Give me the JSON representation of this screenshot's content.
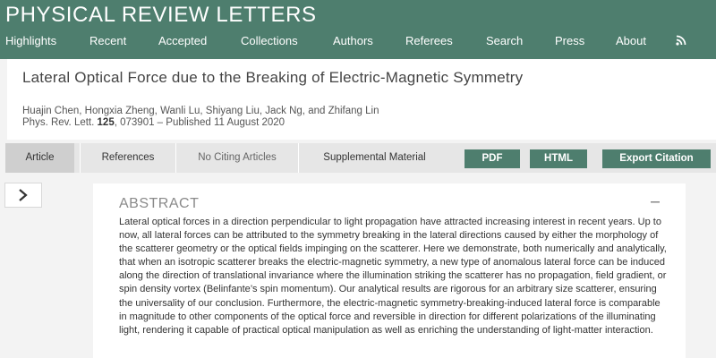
{
  "journal": {
    "title": "PHYSICAL REVIEW LETTERS"
  },
  "nav": {
    "items": [
      "Highlights",
      "Recent",
      "Accepted",
      "Collections",
      "Authors",
      "Referees",
      "Search",
      "Press",
      "About"
    ],
    "rss_icon": "rss-icon"
  },
  "article": {
    "title": "Lateral Optical Force due to the Breaking of Electric-Magnetic Symmetry",
    "authors": "Huajin Chen, Hongxia Zheng, Wanli Lu, Shiyang Liu, Jack Ng, and Zhifang Lin",
    "journal_abbrev": "Phys. Rev. Lett.",
    "volume": "125",
    "citation_rest": ", 073901 – Published 11 August 2020"
  },
  "tabs": {
    "article": "Article",
    "references": "References",
    "citing": "No Citing Articles",
    "supplemental": "Supplemental Material"
  },
  "buttons": {
    "pdf": "PDF",
    "html": "HTML",
    "export": "Export Citation"
  },
  "abstract": {
    "heading": "ABSTRACT",
    "text": "Lateral optical forces in a direction perpendicular to light propagation have attracted increasing interest in recent years. Up to now, all lateral forces can be attributed to the symmetry breaking in the lateral directions caused by either the morphology of the scatterer geometry or the optical fields impinging on the scatterer. Here we demonstrate, both numerically and analytically, that when an isotropic scatterer breaks the electric-magnetic symmetry, a new type of anomalous lateral force can be induced along the direction of translational invariance where the illumination striking the scatterer has no propagation, field gradient, or spin density vortex (Belinfante’s spin momentum). Our analytical results are rigorous for an arbitrary size scatterer, ensuring the universality of our conclusion. Furthermore, the electric-magnetic symmetry-breaking-induced lateral force is comparable in magnitude to other components of the optical force and reversible in direction for different polarizations of the illuminating light, rendering it capable of practical optical manipulation as well as enriching the understanding of light-matter interaction."
  },
  "colors": {
    "brand_green": "#4e7e6e",
    "tab_bar": "#e6e6e6",
    "active_tab": "#cfcfcf",
    "page_bg": "#f3f3f3"
  }
}
